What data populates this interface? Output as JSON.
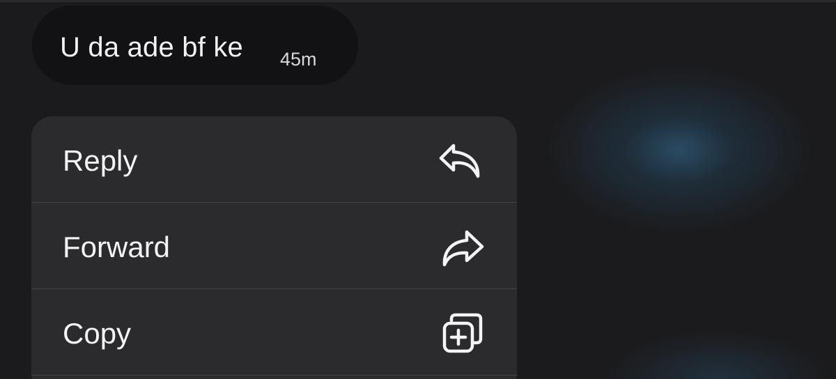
{
  "message": {
    "text": "U da ade bf ke",
    "time": "45m"
  },
  "context_menu": {
    "items": [
      {
        "label": "Reply",
        "icon": "reply-icon"
      },
      {
        "label": "Forward",
        "icon": "forward-icon"
      },
      {
        "label": "Copy",
        "icon": "copy-icon"
      }
    ]
  },
  "colors": {
    "background": "#1b1b1d",
    "bubble": "#121214",
    "menu": "#2b2b2e",
    "text": "#f4f4f6"
  }
}
